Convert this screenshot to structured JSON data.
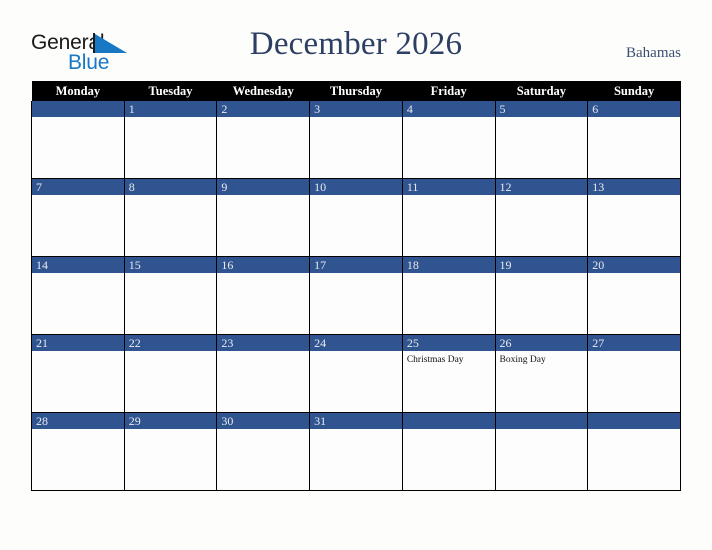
{
  "logo": {
    "word_one": "General",
    "word_two": "Blue",
    "triangle_color": "#1878c4",
    "text_color": "#1a1a1a"
  },
  "header": {
    "title": "December 2026",
    "country": "Bahamas",
    "title_color": "#2d3f63"
  },
  "calendar": {
    "month": "December",
    "year": "2026",
    "weekday_headers": [
      "Monday",
      "Tuesday",
      "Wednesday",
      "Thursday",
      "Friday",
      "Saturday",
      "Sunday"
    ],
    "header_background": "#000000",
    "header_text_color": "#ffffff",
    "date_band_color": "#30548f",
    "date_text_color": "#e8eaf0",
    "cell_background": "#fdfdfd",
    "grid_line_color": "#000000",
    "weeks": [
      [
        {
          "date": "",
          "events": []
        },
        {
          "date": "1",
          "events": []
        },
        {
          "date": "2",
          "events": []
        },
        {
          "date": "3",
          "events": []
        },
        {
          "date": "4",
          "events": []
        },
        {
          "date": "5",
          "events": []
        },
        {
          "date": "6",
          "events": []
        }
      ],
      [
        {
          "date": "7",
          "events": []
        },
        {
          "date": "8",
          "events": []
        },
        {
          "date": "9",
          "events": []
        },
        {
          "date": "10",
          "events": []
        },
        {
          "date": "11",
          "events": []
        },
        {
          "date": "12",
          "events": []
        },
        {
          "date": "13",
          "events": []
        }
      ],
      [
        {
          "date": "14",
          "events": []
        },
        {
          "date": "15",
          "events": []
        },
        {
          "date": "16",
          "events": []
        },
        {
          "date": "17",
          "events": []
        },
        {
          "date": "18",
          "events": []
        },
        {
          "date": "19",
          "events": []
        },
        {
          "date": "20",
          "events": []
        }
      ],
      [
        {
          "date": "21",
          "events": []
        },
        {
          "date": "22",
          "events": []
        },
        {
          "date": "23",
          "events": []
        },
        {
          "date": "24",
          "events": []
        },
        {
          "date": "25",
          "events": [
            "Christmas Day"
          ]
        },
        {
          "date": "26",
          "events": [
            "Boxing Day"
          ]
        },
        {
          "date": "27",
          "events": []
        }
      ],
      [
        {
          "date": "28",
          "events": []
        },
        {
          "date": "29",
          "events": []
        },
        {
          "date": "30",
          "events": []
        },
        {
          "date": "31",
          "events": []
        },
        {
          "date": "",
          "events": []
        },
        {
          "date": "",
          "events": []
        },
        {
          "date": "",
          "events": []
        }
      ]
    ]
  }
}
